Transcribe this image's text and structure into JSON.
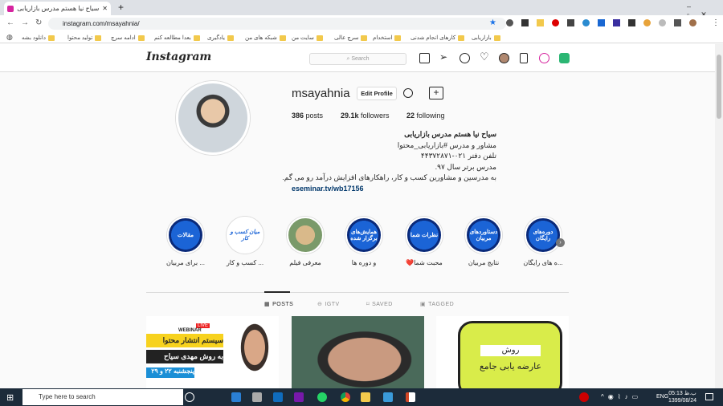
{
  "browser": {
    "tab_title": "سیاح نیا هستم مدرس بازاریابی (@",
    "url": "instagram.com/msayahnia/",
    "bookmarks": [
      "بازاریابی",
      "کارهای انجام شدنی",
      "استخدام",
      "سرچ عالی",
      "سایت من",
      "شبکه های من",
      "یادگیری",
      "بعدا مطالعه کنم",
      "ادامه سرچ",
      "تولید محتوا",
      "دانلود بشه"
    ]
  },
  "instagram": {
    "logo": "Instagram",
    "search_placeholder": "Search"
  },
  "profile": {
    "username": "msayahnia",
    "edit_label": "Edit Profile",
    "posts": "386",
    "posts_label": "posts",
    "followers": "29.1k",
    "followers_label": "followers",
    "following": "22",
    "following_label": "following",
    "bio": [
      "سیاح نیا هستم مدرس بازاریابی",
      "مشاور و مدرس #بازاریابی_محتوا",
      "تلفن دفتر ۰۲۱-۴۴۳۷۲۸۷۱",
      "مدرس برتر سال ۹۷.",
      "به مدرسین و مشاورین کسب و کار، راهکارهای افزایش درآمد رو می گم."
    ],
    "link": "eseminar.tv/wb17156"
  },
  "highlights": [
    {
      "cover": "مقالات",
      "label": "... برای مربیان"
    },
    {
      "cover": "میان کسب و کار",
      "label": "... کسب و کار"
    },
    {
      "cover": "",
      "label": "معرفی فیلم"
    },
    {
      "cover": "همایش‌های برگزار شده",
      "label": "و دوره ها"
    },
    {
      "cover": "نظرات شما",
      "label": "محبت شما❤️"
    },
    {
      "cover": "دستاوردهای مربیان",
      "label": "نتایج مربیان"
    },
    {
      "cover": "دوره‌های رایگان",
      "label": "...ه های رایگان"
    }
  ],
  "tabs": [
    "POSTS",
    "IGTV",
    "SAVED",
    "TAGGED"
  ],
  "posts": [
    {
      "badge": "LIVE",
      "tag": "WEBINAR",
      "line1": "سیستم انتشار محتوا",
      "line2": "به روش مهدی سیاح",
      "line3": "پنجشنبه ۲۲ و ۲۹"
    },
    {
      "caption": ""
    },
    {
      "line1": "روش",
      "line2": "عارضه یابی جامع"
    }
  ],
  "taskbar": {
    "search_placeholder": "Type here to search",
    "lang": "ENG",
    "time": "05:13 ب.ظ",
    "date": "1399/08/24"
  }
}
